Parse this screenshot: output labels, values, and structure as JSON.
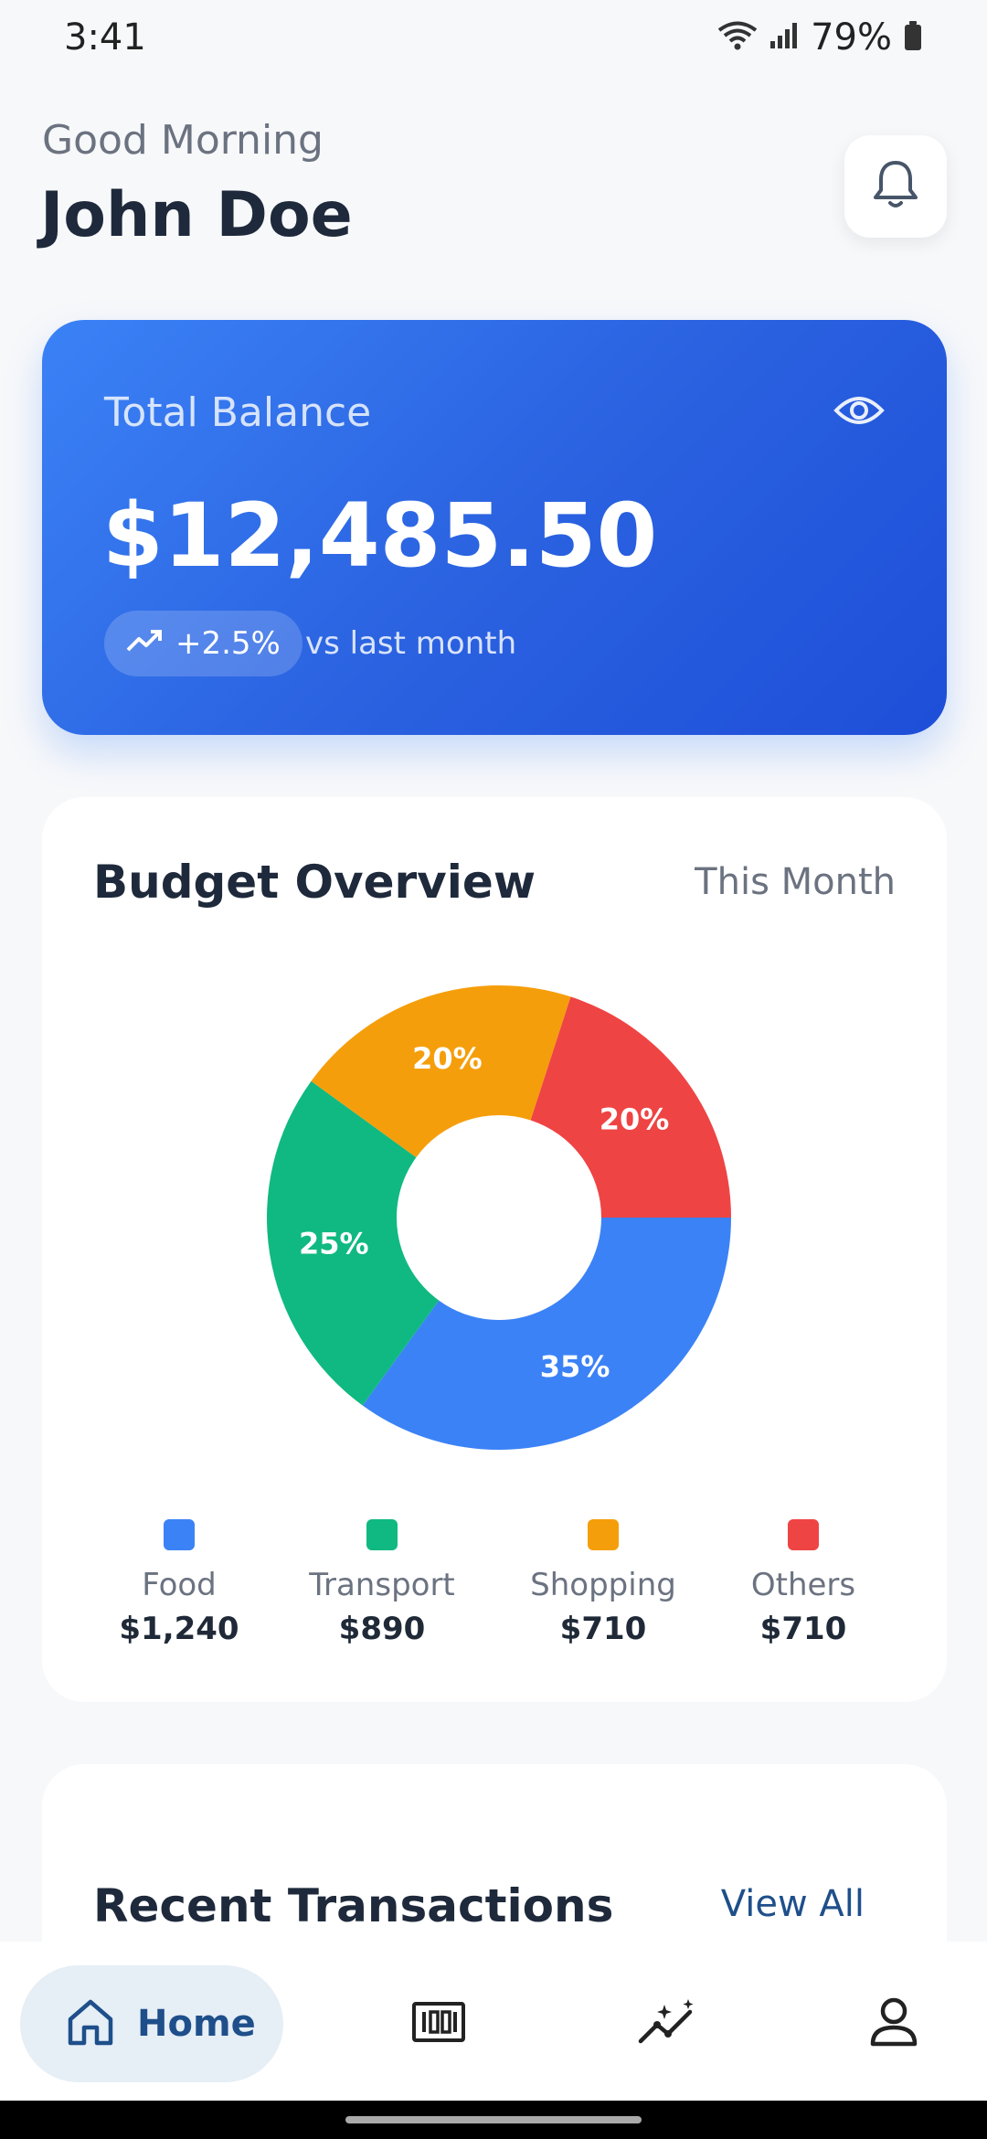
{
  "status_bar": {
    "time": "3:41",
    "battery": "79%"
  },
  "header": {
    "greeting": "Good Morning",
    "name": "John Doe"
  },
  "balance": {
    "label": "Total Balance",
    "amount": "$12,485.50",
    "change": "+2.5%",
    "caption": "vs last month"
  },
  "budget": {
    "title": "Budget Overview",
    "period": "This Month",
    "legend": [
      {
        "name": "Food",
        "value": "$1,240"
      },
      {
        "name": "Transport",
        "value": "$890"
      },
      {
        "name": "Shopping",
        "value": "$710"
      },
      {
        "name": "Others",
        "value": "$710"
      }
    ]
  },
  "chart_data": {
    "type": "pie",
    "categories": [
      "Food",
      "Transport",
      "Shopping",
      "Others"
    ],
    "values": [
      35,
      25,
      20,
      20
    ],
    "labels": [
      "35%",
      "25%",
      "20%",
      "20%"
    ],
    "colors": [
      "#3b82f6",
      "#10b981",
      "#f59e0b",
      "#ef4444"
    ],
    "donut": true
  },
  "transactions": {
    "title": "Recent Transactions",
    "view_all": "View All"
  },
  "nav": {
    "home_label": "Home",
    "items": [
      {
        "icon": "home-icon"
      },
      {
        "icon": "budget-icon"
      },
      {
        "icon": "analytics-icon"
      },
      {
        "icon": "profile-icon"
      }
    ]
  },
  "colors": {
    "accent": "#3b82f6",
    "nav_active_bg": "#e6eef6",
    "nav_active_text": "#1e4f8a"
  }
}
